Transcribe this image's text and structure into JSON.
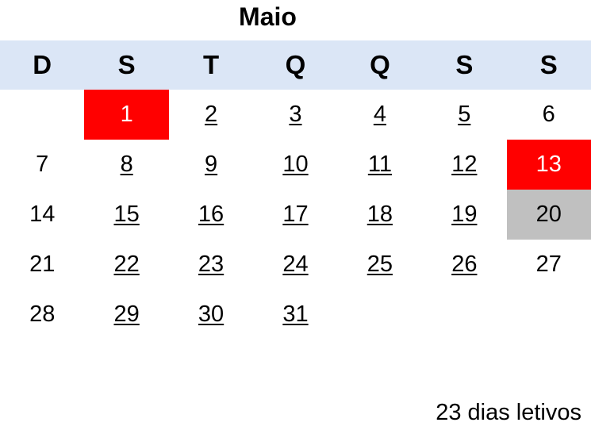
{
  "title": "Maio",
  "weekdays": [
    "D",
    "S",
    "T",
    "Q",
    "Q",
    "S",
    "S"
  ],
  "highlight_colors": {
    "feriado": "#ff0000",
    "cinza": "#c0c0c0",
    "header_bg": "#dbe6f6"
  },
  "days": [
    {
      "n": "",
      "type": "empty"
    },
    {
      "n": "1",
      "type": "feriado"
    },
    {
      "n": "2",
      "type": "letivo"
    },
    {
      "n": "3",
      "type": "letivo"
    },
    {
      "n": "4",
      "type": "letivo"
    },
    {
      "n": "5",
      "type": "letivo"
    },
    {
      "n": "6",
      "type": "normal"
    },
    {
      "n": "7",
      "type": "normal"
    },
    {
      "n": "8",
      "type": "letivo"
    },
    {
      "n": "9",
      "type": "letivo"
    },
    {
      "n": "10",
      "type": "letivo"
    },
    {
      "n": "11",
      "type": "letivo"
    },
    {
      "n": "12",
      "type": "letivo"
    },
    {
      "n": "13",
      "type": "feriado"
    },
    {
      "n": "14",
      "type": "normal"
    },
    {
      "n": "15",
      "type": "letivo"
    },
    {
      "n": "16",
      "type": "letivo"
    },
    {
      "n": "17",
      "type": "letivo"
    },
    {
      "n": "18",
      "type": "letivo"
    },
    {
      "n": "19",
      "type": "letivo"
    },
    {
      "n": "20",
      "type": "cinza"
    },
    {
      "n": "21",
      "type": "normal"
    },
    {
      "n": "22",
      "type": "letivo"
    },
    {
      "n": "23",
      "type": "letivo"
    },
    {
      "n": "24",
      "type": "letivo"
    },
    {
      "n": "25",
      "type": "letivo"
    },
    {
      "n": "26",
      "type": "letivo"
    },
    {
      "n": "27",
      "type": "normal"
    },
    {
      "n": "28",
      "type": "normal"
    },
    {
      "n": "29",
      "type": "letivo"
    },
    {
      "n": "30",
      "type": "letivo"
    },
    {
      "n": "31",
      "type": "letivo"
    }
  ],
  "footer": "23 dias letivos"
}
